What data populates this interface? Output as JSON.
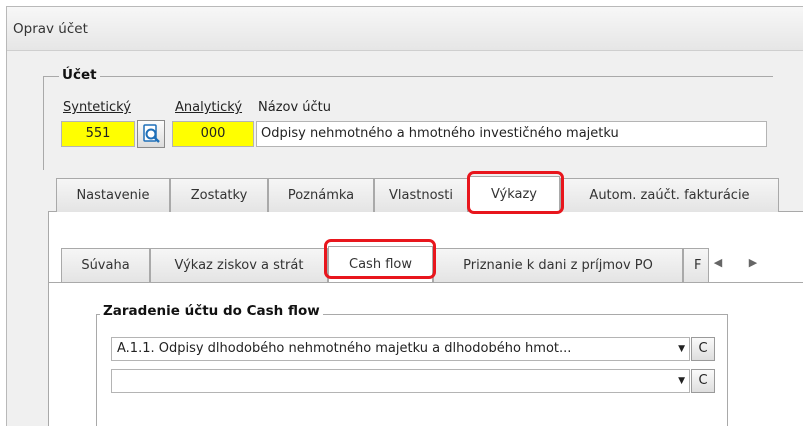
{
  "window": {
    "title": "Oprav účet"
  },
  "ucet_group": {
    "legend": "Účet",
    "labels": {
      "syntetic": "Syntetický",
      "analytic": "Analytický",
      "name": "Názov účtu"
    },
    "values": {
      "syntetic": "551",
      "analytic": "000",
      "name": "Odpisy nehmotného a hmotného investičného majetku"
    }
  },
  "tabs": [
    "Nastavenie",
    "Zostatky",
    "Poznámka",
    "Vlastnosti",
    "Výkazy",
    "Autom. zaúčt. fakturácie"
  ],
  "subtabs": [
    "Súvaha",
    "Výkaz ziskov a strát",
    "Cash flow",
    "Priznanie k dani z príjmov PO",
    "F"
  ],
  "cashflow_group": {
    "legend": "Zaradenie účtu do Cash flow",
    "rows": [
      {
        "value": "A.1.1. Odpisy dlhodobého nehmotného majetku a dlhodobého hmot...",
        "clear_label": "C"
      },
      {
        "value": "",
        "clear_label": "C"
      }
    ]
  },
  "icons": {
    "lookup": "magnifier-icon",
    "combo_arrow": "dropdown-arrow-icon",
    "scroll_left": "chevron-left-icon",
    "scroll_right": "chevron-right-icon"
  },
  "colors": {
    "highlight": "#e8161d",
    "required_field": "#ffff00"
  }
}
